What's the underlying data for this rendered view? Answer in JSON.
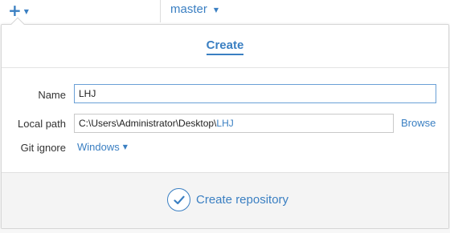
{
  "toolbar": {
    "add_icon": "plus-icon",
    "add_caret_icon": "caret-down-icon",
    "branch": "master",
    "branch_caret_icon": "caret-down-icon"
  },
  "panel": {
    "tabs": [
      {
        "label": "Create",
        "active": true
      }
    ],
    "fields": {
      "name_label": "Name",
      "name_value": "LHJ",
      "path_label": "Local path",
      "path_prefix": "C:\\Users\\Administrator\\Desktop\\",
      "path_suffix": "LHJ",
      "browse_label": "Browse",
      "gitignore_label": "Git ignore",
      "gitignore_value": "Windows"
    },
    "footer": {
      "create_label": "Create repository",
      "create_icon": "checkmark-circle-icon"
    }
  },
  "colors": {
    "accent": "#3a7fc2",
    "border": "#d6d6d6",
    "footer_bg": "#f4f4f4"
  }
}
